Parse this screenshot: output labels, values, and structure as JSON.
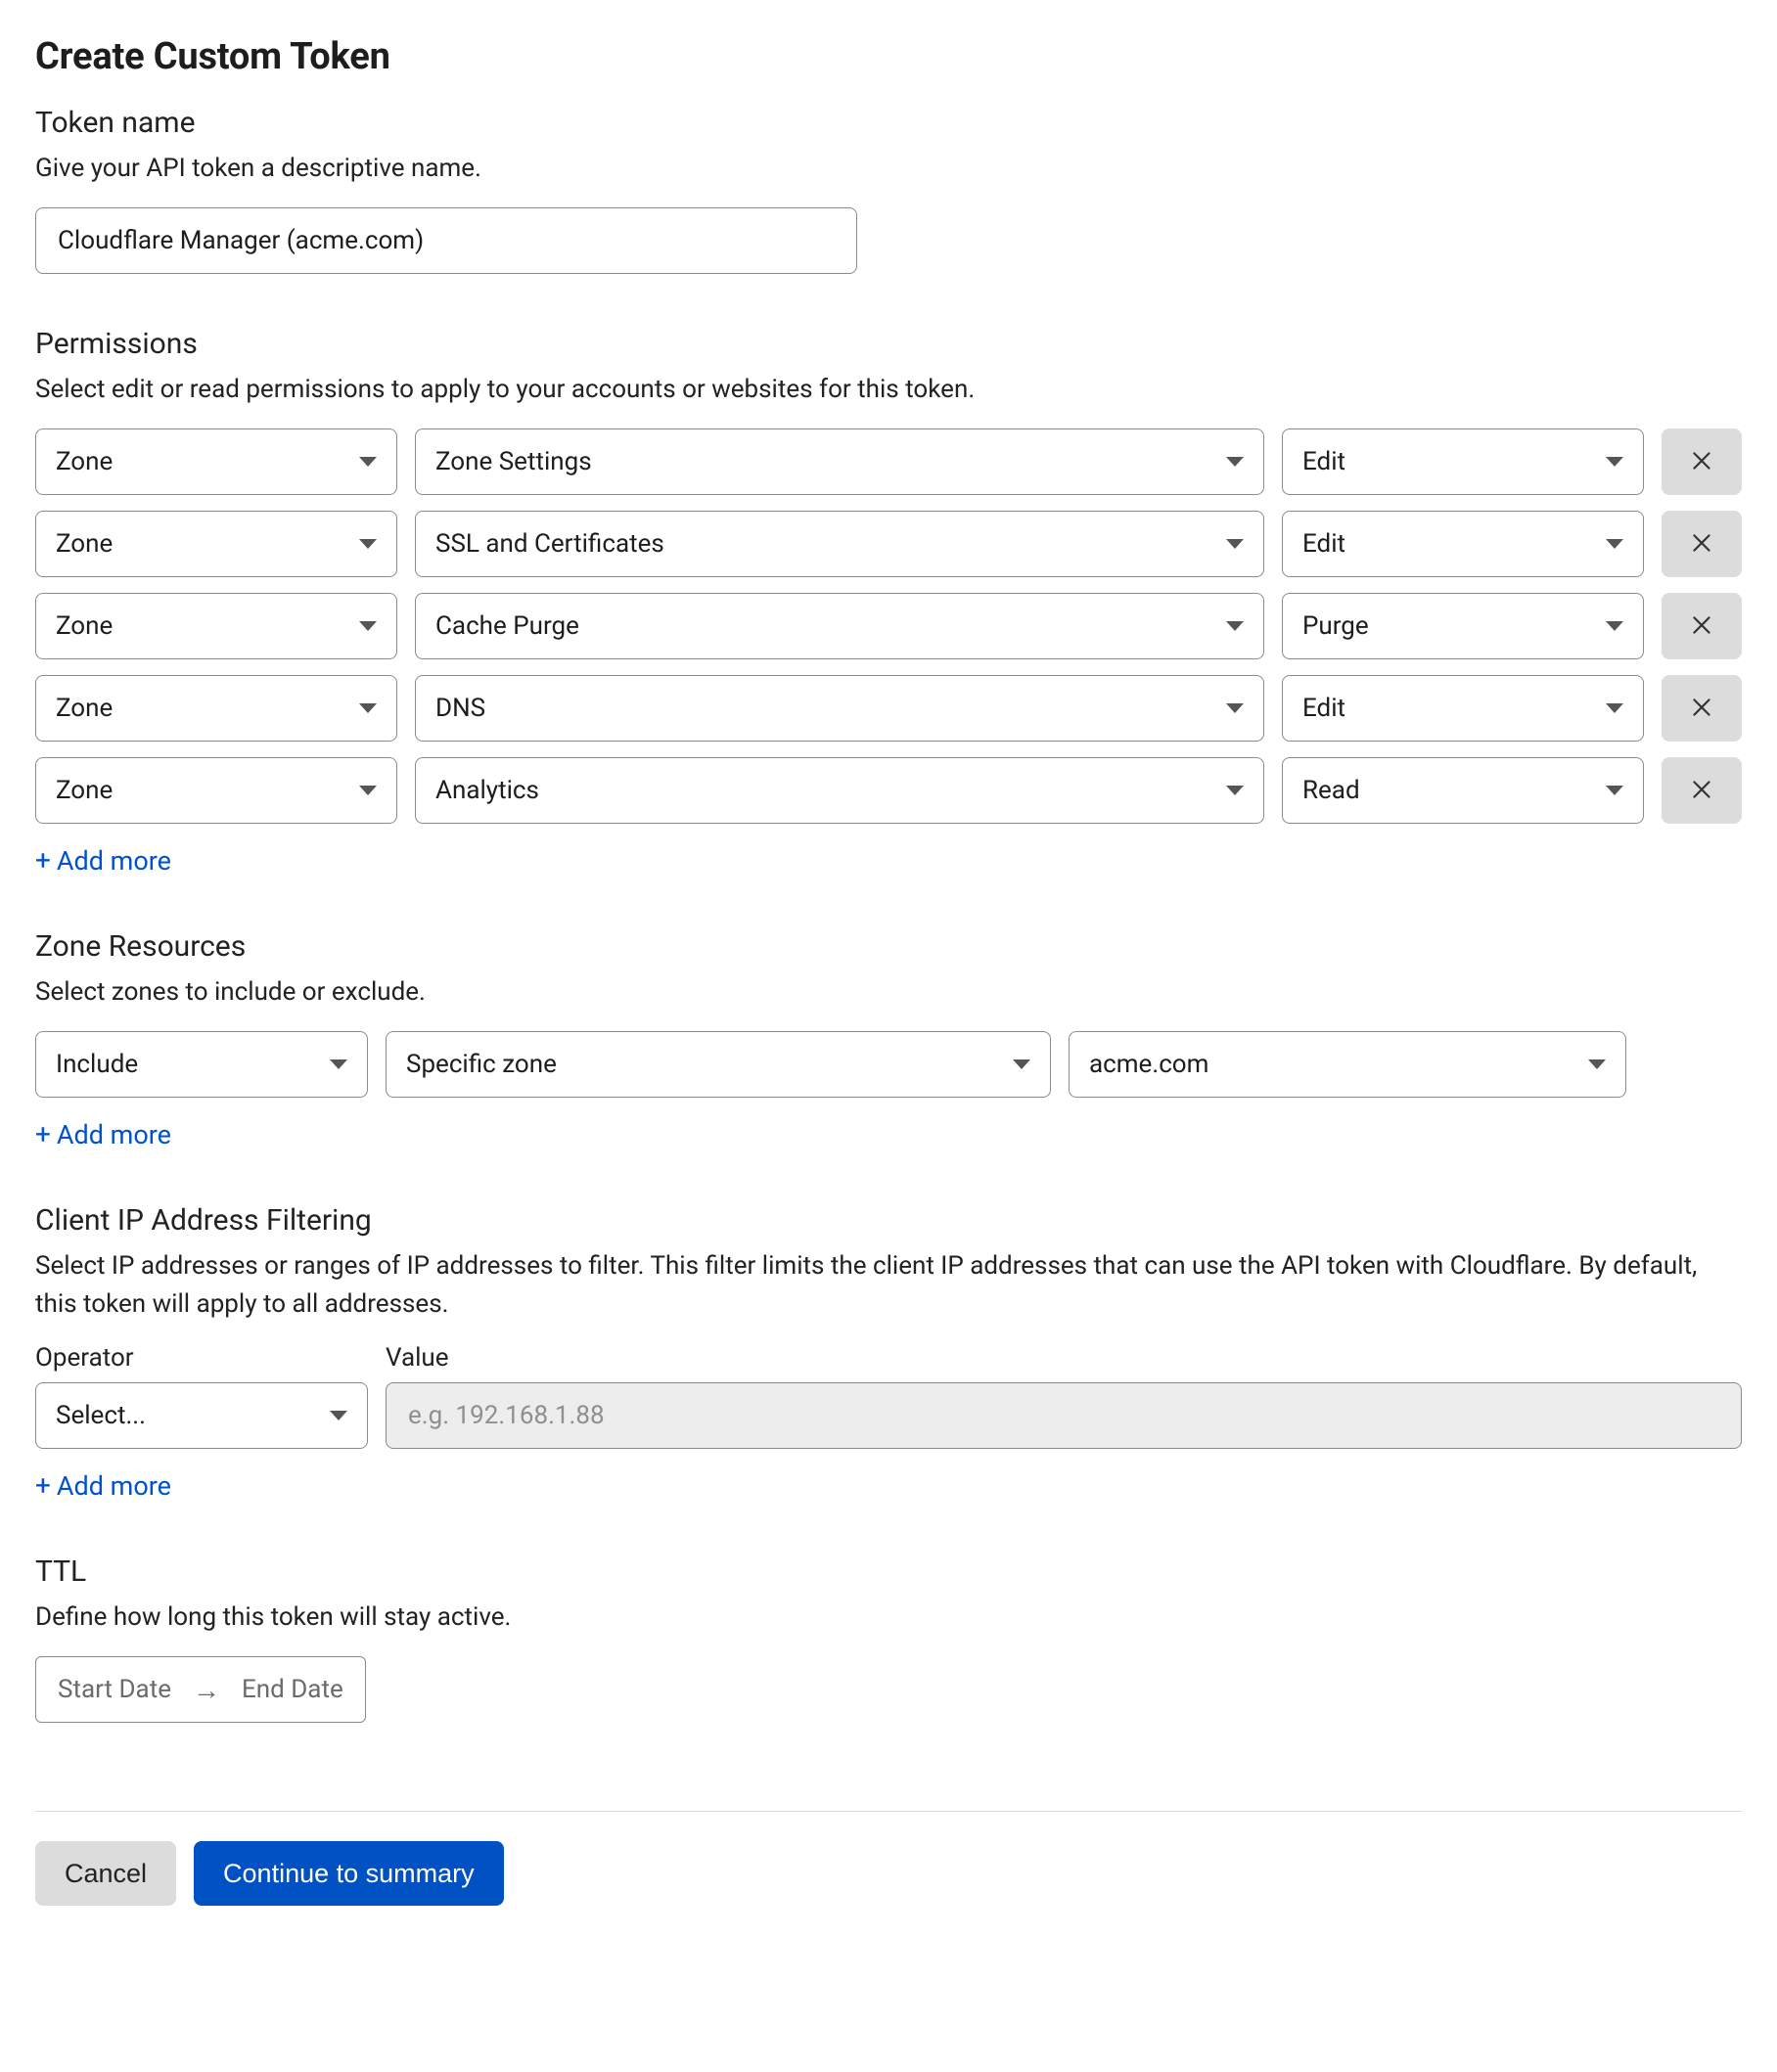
{
  "page_title": "Create Custom Token",
  "token_name": {
    "heading": "Token name",
    "desc": "Give your API token a descriptive name.",
    "value": "Cloudflare Manager (acme.com)"
  },
  "permissions": {
    "heading": "Permissions",
    "desc": "Select edit or read permissions to apply to your accounts or websites for this token.",
    "rows": [
      {
        "scope": "Zone",
        "resource": "Zone Settings",
        "level": "Edit"
      },
      {
        "scope": "Zone",
        "resource": "SSL and Certificates",
        "level": "Edit"
      },
      {
        "scope": "Zone",
        "resource": "Cache Purge",
        "level": "Purge"
      },
      {
        "scope": "Zone",
        "resource": "DNS",
        "level": "Edit"
      },
      {
        "scope": "Zone",
        "resource": "Analytics",
        "level": "Read"
      }
    ],
    "add_more": "Add more"
  },
  "zone_resources": {
    "heading": "Zone Resources",
    "desc": "Select zones to include or exclude.",
    "rows": [
      {
        "mode": "Include",
        "scope": "Specific zone",
        "zone": "acme.com"
      }
    ],
    "add_more": "Add more"
  },
  "ip_filter": {
    "heading": "Client IP Address Filtering",
    "desc": "Select IP addresses or ranges of IP addresses to filter. This filter limits the client IP addresses that can use the API token with Cloudflare. By default, this token will apply to all addresses.",
    "operator_label": "Operator",
    "value_label": "Value",
    "operator_value": "Select...",
    "value_placeholder": "e.g. 192.168.1.88",
    "add_more": "Add more"
  },
  "ttl": {
    "heading": "TTL",
    "desc": "Define how long this token will stay active.",
    "start": "Start Date",
    "end": "End Date"
  },
  "footer": {
    "cancel": "Cancel",
    "continue": "Continue to summary"
  }
}
